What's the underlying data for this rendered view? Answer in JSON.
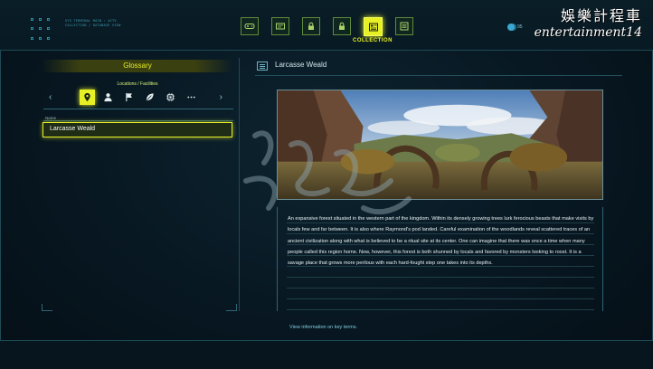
{
  "app": {
    "watermark_line1": "娛樂計程車",
    "watermark_line2": "entertainment14",
    "currency_value": "95",
    "active_tab_label": "COLLECTION",
    "system_info": [
      "SYS TERMINAL   MAIN : ACTV",
      "COLLECTION / DATABASE VIEW"
    ]
  },
  "tabs": [
    {
      "icon": "gamepad-icon"
    },
    {
      "icon": "card-icon"
    },
    {
      "icon": "lock-icon"
    },
    {
      "icon": "lock-icon"
    },
    {
      "icon": "collection-icon",
      "active": true
    },
    {
      "icon": "settings-list-icon"
    }
  ],
  "glossary": {
    "header": "Glossary",
    "category_label": "Locations / Facilities",
    "categories": [
      {
        "icon": "map-pin-icon",
        "active": true
      },
      {
        "icon": "person-icon"
      },
      {
        "icon": "flag-icon"
      },
      {
        "icon": "leaf-icon"
      },
      {
        "icon": "chip-icon"
      },
      {
        "icon": "more-icon"
      }
    ],
    "column_name": "Name",
    "entries": [
      "Larcasse Weald"
    ]
  },
  "detail": {
    "title": "Larcasse Weald",
    "description": "An expansive forest situated in the western part of the kingdom. Within its densely growing trees lurk ferocious beasts that make visits by locals few and far between. It is also where Raymond's pod landed. Careful examination of the woodlands reveal scattered traces of an ancient civilization along with what is believed to be a ritual site at its center. One can imagine that there was once a time when many people called this region home. Now, however, this forest is both shunned by locals and favored by monsters looking to roost. It is a savage place that grows more perilous with each hard-fought step one takes into its depths.",
    "footnote": "View information on key terms."
  },
  "colors": {
    "accent": "#e6f025",
    "panel_line": "#2e6572",
    "background": "#06121a"
  }
}
